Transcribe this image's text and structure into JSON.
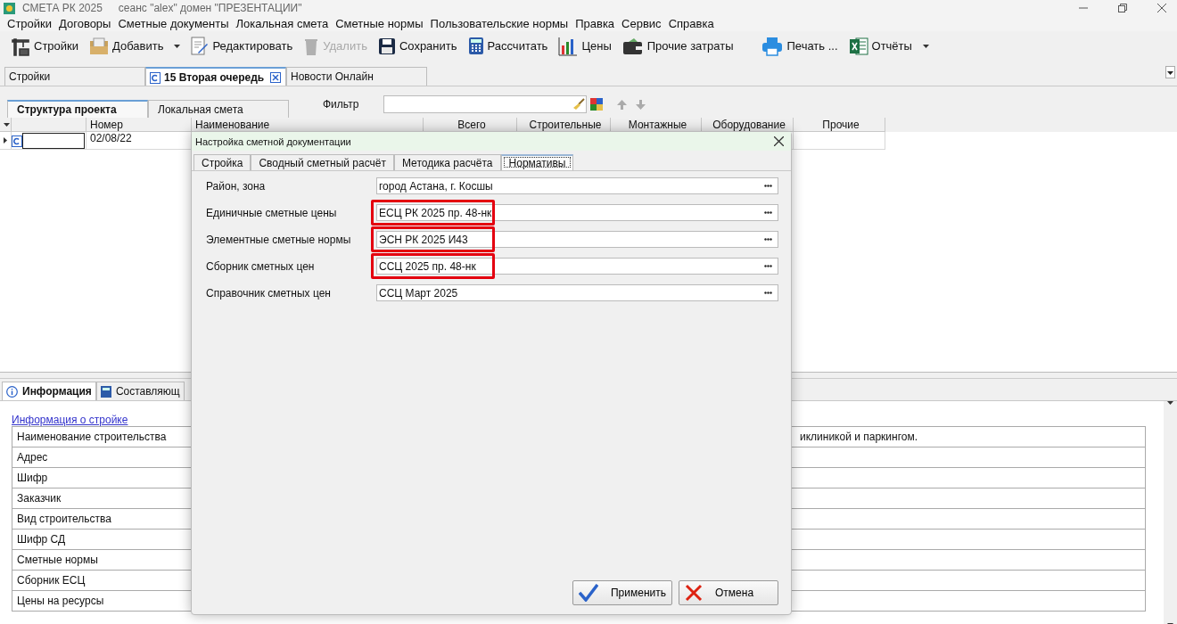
{
  "window": {
    "title": "СМЕТА РК 2025",
    "session": "сеанс \"alex\"  домен \"ПРЕЗЕНТАЦИИ\""
  },
  "menu": [
    "Стройки",
    "Договоры",
    "Сметные документы",
    "Локальная смета",
    "Сметные нормы",
    "Пользовательские нормы",
    "Правка",
    "Сервис",
    "Справка"
  ],
  "toolbar": [
    {
      "kind": "crane",
      "label": "Стройки",
      "disabled": false,
      "dropdown": false
    },
    {
      "kind": "add",
      "label": "Добавить",
      "disabled": false,
      "dropdown": true
    },
    {
      "kind": "edit",
      "label": "Редактировать",
      "disabled": false,
      "dropdown": false
    },
    {
      "kind": "delete",
      "label": "Удалить",
      "disabled": true,
      "dropdown": false
    },
    {
      "kind": "save",
      "label": "Сохранить",
      "disabled": false,
      "dropdown": false
    },
    {
      "kind": "calc",
      "label": "Рассчитать",
      "disabled": false,
      "dropdown": false
    },
    {
      "kind": "chart",
      "label": "Цены",
      "disabled": false,
      "dropdown": false
    },
    {
      "kind": "wallet",
      "label": "Прочие затраты",
      "disabled": false,
      "dropdown": false
    },
    {
      "kind": "print",
      "label": "Печать ...",
      "disabled": false,
      "dropdown": false
    },
    {
      "kind": "excel",
      "label": "Отчёты",
      "disabled": false,
      "dropdown": true
    }
  ],
  "doc_tabs": [
    {
      "label": "Стройки",
      "selected": false,
      "closable": false
    },
    {
      "label": "15 Вторая очередь",
      "selected": true,
      "closable": true
    },
    {
      "label": "Новости Онлайн",
      "selected": false,
      "closable": false
    }
  ],
  "view_tabs": [
    {
      "label": "Структура проекта",
      "selected": true
    },
    {
      "label": "Локальная смета",
      "selected": false
    }
  ],
  "filter": {
    "label": "Фильтр"
  },
  "grid": {
    "columns": [
      "Номер",
      "Наименование",
      "Всего",
      "Строительные",
      "Монтажные",
      "Оборудование",
      "Прочие"
    ],
    "rows": [
      {
        "number": "02/08/22",
        "current": true
      }
    ]
  },
  "dialog": {
    "title": "Настройка сметной документации",
    "tabs": [
      {
        "label": "Стройка",
        "selected": false
      },
      {
        "label": "Сводный сметный расчёт",
        "selected": false
      },
      {
        "label": "Методика расчёта",
        "selected": false
      },
      {
        "label": "Нормативы",
        "selected": true
      }
    ],
    "fields": [
      {
        "label": "Район, зона",
        "value": "город Астана, г. Косшы",
        "highlighted": false
      },
      {
        "label": "Единичные сметные цены",
        "value": "ЕСЦ РК 2025 пр. 48-нк",
        "highlighted": true
      },
      {
        "label": "Элементные сметные нормы",
        "value": "ЭСН РК 2025 И43",
        "highlighted": true
      },
      {
        "label": "Сборник сметных цен",
        "value": "ССЦ 2025 пр. 48-нк",
        "highlighted": true
      },
      {
        "label": "Справочник сметных цен",
        "value": "ССЦ Март 2025",
        "highlighted": false
      }
    ],
    "buttons": [
      {
        "kind": "apply",
        "label": "Применить"
      },
      {
        "kind": "cancel",
        "label": "Отмена"
      }
    ]
  },
  "bottom_panel": {
    "tabs": [
      {
        "label": "Информация",
        "kind": "info",
        "selected": true
      },
      {
        "label": "Составляющ",
        "kind": "calc",
        "selected": false
      }
    ],
    "section_link": "Информация о стройке",
    "rows": [
      {
        "label": "Наименование строительства",
        "value": "иклиникой и паркингом."
      },
      {
        "label": "Адрес"
      },
      {
        "label": "Шифр"
      },
      {
        "label": "Заказчик"
      },
      {
        "label": "Вид строительства"
      },
      {
        "label": "Шифр СД"
      },
      {
        "label": "Сметные нормы"
      },
      {
        "label": "Сборник ЕСЦ"
      },
      {
        "label": "Цены на ресурсы"
      }
    ]
  }
}
